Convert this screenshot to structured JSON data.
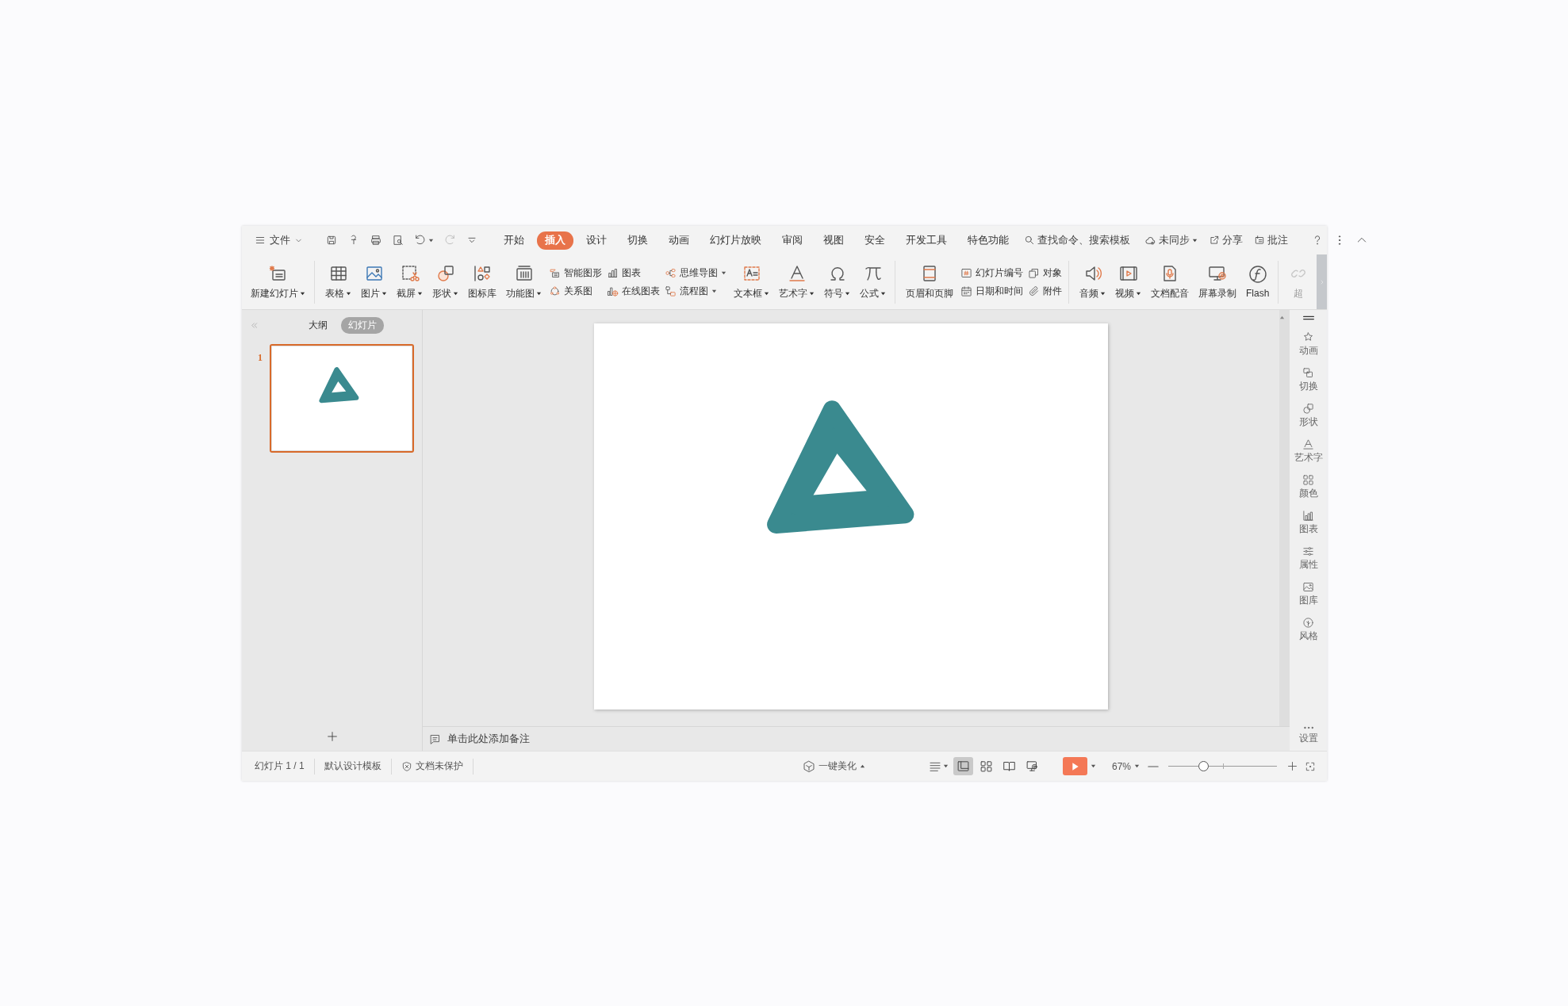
{
  "menu_bar": {
    "file_menu": "文件",
    "tabs": [
      {
        "label": "开始",
        "selected": false
      },
      {
        "label": "插入",
        "selected": true
      },
      {
        "label": "设计",
        "selected": false
      },
      {
        "label": "切换",
        "selected": false
      },
      {
        "label": "动画",
        "selected": false
      },
      {
        "label": "幻灯片放映",
        "selected": false
      },
      {
        "label": "审阅",
        "selected": false
      },
      {
        "label": "视图",
        "selected": false
      },
      {
        "label": "安全",
        "selected": false
      },
      {
        "label": "开发工具",
        "selected": false
      },
      {
        "label": "特色功能",
        "selected": false
      }
    ],
    "search": "查找命令、搜索模板",
    "sync": "未同步",
    "share": "分享",
    "comment": "批注"
  },
  "ribbon": {
    "groups": [
      [
        {
          "kind": "large",
          "label": "新建幻灯片",
          "dropdown": true,
          "disabled": false
        }
      ],
      [
        {
          "kind": "large",
          "label": "表格",
          "dropdown": true,
          "disabled": false
        },
        {
          "kind": "large",
          "label": "图片",
          "dropdown": true,
          "disabled": false
        },
        {
          "kind": "large",
          "label": "截屏",
          "dropdown": true,
          "disabled": false
        },
        {
          "kind": "large",
          "label": "形状",
          "dropdown": true,
          "disabled": false
        },
        {
          "kind": "large",
          "label": "图标库",
          "dropdown": false,
          "disabled": false
        },
        {
          "kind": "large",
          "label": "功能图",
          "dropdown": true,
          "disabled": false
        },
        {
          "kind": "stack",
          "items": [
            {
              "label": "智能图形",
              "dropdown": false
            },
            {
              "label": "关系图",
              "dropdown": false
            }
          ]
        },
        {
          "kind": "stack",
          "items": [
            {
              "label": "图表",
              "dropdown": false
            },
            {
              "label": "在线图表",
              "dropdown": false
            }
          ]
        },
        {
          "kind": "stack",
          "items": [
            {
              "label": "思维导图",
              "dropdown": true
            },
            {
              "label": "流程图",
              "dropdown": true
            }
          ]
        },
        {
          "kind": "large",
          "label": "文本框",
          "dropdown": true,
          "disabled": false
        },
        {
          "kind": "large",
          "label": "艺术字",
          "dropdown": true,
          "disabled": false
        },
        {
          "kind": "large",
          "label": "符号",
          "dropdown": true,
          "disabled": false
        },
        {
          "kind": "large",
          "label": "公式",
          "dropdown": true,
          "disabled": false
        }
      ],
      [
        {
          "kind": "large",
          "label": "页眉和页脚",
          "dropdown": false,
          "disabled": false
        },
        {
          "kind": "stack",
          "items": [
            {
              "label": "幻灯片编号",
              "dropdown": false
            },
            {
              "label": "日期和时间",
              "dropdown": false
            }
          ]
        },
        {
          "kind": "stack",
          "items": [
            {
              "label": "对象",
              "dropdown": false
            },
            {
              "label": "附件",
              "dropdown": false
            }
          ]
        }
      ],
      [
        {
          "kind": "large",
          "label": "音频",
          "dropdown": true,
          "disabled": false
        },
        {
          "kind": "large",
          "label": "视频",
          "dropdown": true,
          "disabled": false
        },
        {
          "kind": "large",
          "label": "文档配音",
          "dropdown": false,
          "disabled": false
        },
        {
          "kind": "large",
          "label": "屏幕录制",
          "dropdown": false,
          "disabled": false
        },
        {
          "kind": "large",
          "label": "Flash",
          "dropdown": false,
          "disabled": false
        }
      ],
      [
        {
          "kind": "large",
          "label": "超",
          "dropdown": false,
          "disabled": true
        }
      ]
    ]
  },
  "slide_panel": {
    "tabs": [
      {
        "label": "大纲",
        "selected": false
      },
      {
        "label": "幻灯片",
        "selected": true
      }
    ],
    "slides": [
      {
        "number": "1",
        "selected": true
      }
    ]
  },
  "notes": {
    "prompt": "单击此处添加备注"
  },
  "right_sidebar": {
    "items": [
      "动画",
      "切换",
      "形状",
      "艺术字",
      "颜色",
      "图表",
      "属性",
      "图库",
      "风格"
    ],
    "settings": "设置"
  },
  "status_bar": {
    "slide_count": "幻灯片 1 / 1",
    "template": "默认设计模板",
    "protection": "文档未保护",
    "beautify": "一键美化",
    "views": [
      {
        "selected": true
      },
      {
        "selected": false
      },
      {
        "selected": false
      },
      {
        "selected": false
      }
    ],
    "zoom": "67%",
    "zoom_slider": {
      "level": 0.32
    }
  }
}
